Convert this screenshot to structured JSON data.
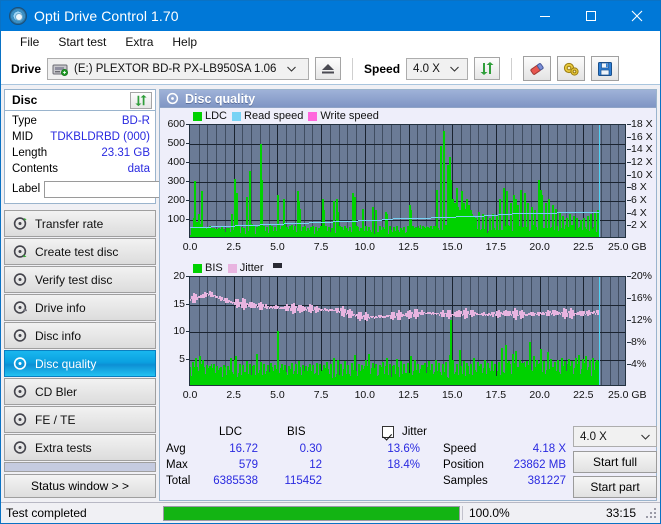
{
  "window": {
    "title": "Opti Drive Control 1.70",
    "icon": "disc-icon",
    "minimize": "minimize-icon",
    "maximize": "maximize-icon",
    "close": "close-icon"
  },
  "menu": {
    "items": [
      "File",
      "Start test",
      "Extra",
      "Help"
    ]
  },
  "toolbar": {
    "drive_label": "Drive",
    "drive_value": "(E:)   PLEXTOR BD-R  PX-LB950SA 1.06",
    "eject_icon": "eject-icon",
    "speed_label": "Speed",
    "speed_value": "4.0 X",
    "refresh_icon": "refresh-icon",
    "eraser_icon": "eraser-icon",
    "settings_icon": "gears-icon",
    "save_icon": "floppy-save-icon"
  },
  "disc": {
    "group_title": "Disc",
    "refresh_icon": "refresh-disc-icon",
    "rows": [
      {
        "key": "Type",
        "value": "BD-R"
      },
      {
        "key": "MID",
        "value": "TDKBLDRBD (000)"
      },
      {
        "key": "Length",
        "value": "23.31 GB"
      },
      {
        "key": "Contents",
        "value": "data"
      }
    ],
    "label_key": "Label",
    "label_value": "",
    "label_placeholder": "",
    "disc_button_icon": "cd-disc-icon"
  },
  "nav": {
    "items": [
      {
        "label": "Transfer rate",
        "selected": false
      },
      {
        "label": "Create test disc",
        "selected": false
      },
      {
        "label": "Verify test disc",
        "selected": false
      },
      {
        "label": "Drive info",
        "selected": false
      },
      {
        "label": "Disc info",
        "selected": false
      },
      {
        "label": "Disc quality",
        "selected": true
      },
      {
        "label": "CD Bler",
        "selected": false
      },
      {
        "label": "FE / TE",
        "selected": false
      },
      {
        "label": "Extra tests",
        "selected": false
      }
    ],
    "status_window": "Status window > >"
  },
  "panel": {
    "title": "Disc quality",
    "icon": "disc-quality-icon"
  },
  "stats": {
    "col_headers": [
      "LDC",
      "BIS"
    ],
    "rows": [
      {
        "key": "Avg",
        "ldc": "16.72",
        "bis": "0.30",
        "jitter": "13.6%"
      },
      {
        "key": "Max",
        "ldc": "579",
        "bis": "12",
        "jitter": "18.4%"
      },
      {
        "key": "Total",
        "ldc": "6385538",
        "bis": "115452",
        "jitter": ""
      }
    ],
    "jitter_label": "Jitter",
    "jitter_checked": true,
    "speed_key": "Speed",
    "speed_value": "4.18 X",
    "position_key": "Position",
    "position_value": "23862 MB",
    "samples_key": "Samples",
    "samples_value": "381227",
    "speed_select_value": "4.0 X",
    "start_full": "Start full",
    "start_part": "Start part"
  },
  "statusbar": {
    "text": "Test completed",
    "percent": "100.0%",
    "progress": 100,
    "time": "33:15"
  },
  "colors": {
    "accent": "#0078d7",
    "plot_bg": "#6b7b96",
    "ldc_green": "#00d200",
    "read_speed": "#78d3f5",
    "write_speed": "#ff66dd",
    "jitter_pink": "#e8b4e0",
    "value_blue": "#2a2ae0",
    "progress_green": "#13b413"
  },
  "chart_data": [
    {
      "type": "area",
      "id": "ldc-chart",
      "title": "",
      "xlabel": "GB",
      "ylabel": "",
      "xlim": [
        0,
        25
      ],
      "ylim": [
        0,
        600
      ],
      "y2lim": [
        0,
        18
      ],
      "y2label": "X",
      "grid": true,
      "legend_position": "top-left",
      "legend": [
        "LDC",
        "Read speed",
        "Write speed"
      ],
      "xticks": [
        0.0,
        2.5,
        5.0,
        7.5,
        10.0,
        12.5,
        15.0,
        17.5,
        20.0,
        22.5,
        25.0
      ],
      "xticklabels": [
        "0.0",
        "2.5",
        "5.0",
        "7.5",
        "10.0",
        "12.5",
        "15.0",
        "17.5",
        "20.0",
        "22.5",
        "25.0 GB"
      ],
      "yticks": [
        100,
        200,
        300,
        400,
        500,
        600
      ],
      "yticklabels": [
        "100",
        "200",
        "300",
        "400",
        "500",
        "600"
      ],
      "y2ticks": [
        2,
        4,
        6,
        8,
        10,
        12,
        14,
        16,
        18
      ],
      "y2ticklabels": [
        "2 X",
        "4 X",
        "6 X",
        "8 X",
        "10 X",
        "12 X",
        "14 X",
        "16 X",
        "18 X"
      ],
      "data_end_x": 23.4,
      "cursor_x": 23.4,
      "series": [
        {
          "name": "LDC",
          "color": "#00d200",
          "baseline": 28,
          "x": [
            0.05,
            0.15,
            0.25,
            0.35,
            0.45,
            0.5,
            0.55,
            0.62,
            0.7,
            0.8,
            0.9,
            1.0,
            1.1,
            1.2,
            1.3,
            1.45,
            1.6,
            1.75,
            1.9,
            2.05,
            2.2,
            2.35,
            2.5,
            2.6,
            2.62,
            2.75,
            2.9,
            3.05,
            3.2,
            3.35,
            3.5,
            3.6,
            3.75,
            3.9,
            4.02,
            4.05,
            4.2,
            4.35,
            4.5,
            4.65,
            4.8,
            4.95,
            5.0,
            5.05,
            5.2,
            5.3,
            5.35,
            5.5,
            5.65,
            5.8,
            5.95,
            6.1,
            6.2,
            6.25,
            6.4,
            6.55,
            6.7,
            6.85,
            7.0,
            7.15,
            7.3,
            7.45,
            7.55,
            7.6,
            7.75,
            7.9,
            8.05,
            8.2,
            8.35,
            8.4,
            8.5,
            8.65,
            8.8,
            8.95,
            9.1,
            9.25,
            9.4,
            9.5,
            9.55,
            9.7,
            9.85,
            10.0,
            10.2,
            10.4,
            10.6,
            10.8,
            11.0,
            11.15,
            11.2,
            11.4,
            11.6,
            11.8,
            12.0,
            12.2,
            12.4,
            12.55,
            12.6,
            12.7,
            12.9,
            13.1,
            13.3,
            13.5,
            13.7,
            13.9,
            14.1,
            14.3,
            14.5,
            14.7,
            14.8,
            14.85,
            14.9,
            15.0,
            15.1,
            15.2,
            15.3,
            15.4,
            15.5,
            15.6,
            15.7,
            15.8,
            15.9,
            16.0,
            16.1,
            16.2,
            16.3,
            16.5,
            16.7,
            16.9,
            17.1,
            17.3,
            17.5,
            17.7,
            17.9,
            18.1,
            18.3,
            18.5,
            18.6,
            18.7,
            18.9,
            19.1,
            19.3,
            19.5,
            19.7,
            19.9,
            20.0,
            20.1,
            20.3,
            20.5,
            20.7,
            20.9,
            21.1,
            21.3,
            21.5,
            21.7,
            21.9,
            22.1,
            22.3,
            22.5,
            22.7,
            22.9,
            23.1,
            23.3
          ],
          "y": [
            55,
            100,
            295,
            80,
            120,
            60,
            70,
            240,
            55,
            45,
            40,
            50,
            60,
            45,
            50,
            40,
            45,
            55,
            40,
            45,
            50,
            120,
            305,
            200,
            230,
            60,
            55,
            50,
            210,
            350,
            70,
            60,
            55,
            65,
            490,
            300,
            60,
            55,
            70,
            60,
            55,
            220,
            210,
            70,
            60,
            200,
            70,
            55,
            60,
            65,
            60,
            240,
            190,
            150,
            55,
            60,
            50,
            55,
            60,
            55,
            50,
            60,
            200,
            140,
            60,
            55,
            50,
            190,
            200,
            130,
            60,
            55,
            60,
            50,
            55,
            230,
            210,
            60,
            55,
            50,
            150,
            60,
            55,
            160,
            140,
            60,
            55,
            130,
            120,
            60,
            55,
            60,
            50,
            55,
            60,
            170,
            140,
            60,
            55,
            50,
            60,
            55,
            50,
            60,
            250,
            480,
            560,
            380,
            420,
            300,
            250,
            200,
            180,
            260,
            160,
            140,
            240,
            180,
            150,
            200,
            170,
            140,
            120,
            110,
            100,
            130,
            120,
            110,
            100,
            120,
            110,
            200,
            260,
            240,
            180,
            220,
            200,
            170,
            250,
            230,
            180,
            160,
            140,
            300,
            250,
            220,
            180,
            200,
            170,
            150,
            130,
            110,
            100,
            120,
            110,
            100,
            90,
            100,
            110,
            120,
            130,
            140
          ]
        },
        {
          "name": "Read speed",
          "color": "#78d3f5",
          "axis": "y2",
          "x": [
            0.0,
            1.2,
            2.6,
            4.0,
            5.4,
            6.8,
            8.2,
            9.6,
            11.0,
            11.6,
            12.4,
            13.8,
            15.2,
            16.0,
            16.8,
            17.6,
            18.4,
            19.2,
            20.0,
            21.0,
            22.2,
            23.2,
            23.4
          ],
          "y": [
            1.9,
            2.1,
            2.25,
            2.4,
            2.55,
            2.7,
            2.85,
            3.0,
            3.15,
            3.3,
            3.35,
            3.5,
            3.6,
            3.7,
            3.8,
            3.9,
            4.05,
            4.1,
            4.15,
            4.2,
            4.25,
            4.3,
            18.0
          ]
        },
        {
          "name": "Write speed",
          "color": "#ff66dd",
          "x": [],
          "y": []
        }
      ]
    },
    {
      "type": "area",
      "id": "bis-chart",
      "title": "",
      "xlabel": "GB",
      "ylabel": "",
      "xlim": [
        0,
        25
      ],
      "ylim": [
        0,
        20
      ],
      "y2lim": [
        0,
        20
      ],
      "y2label": "%",
      "grid": true,
      "legend_position": "top-left",
      "legend": [
        "BIS",
        "Jitter"
      ],
      "xticks": [
        0.0,
        2.5,
        5.0,
        7.5,
        10.0,
        12.5,
        15.0,
        17.5,
        20.0,
        22.5,
        25.0
      ],
      "xticklabels": [
        "0.0",
        "2.5",
        "5.0",
        "7.5",
        "10.0",
        "12.5",
        "15.0",
        "17.5",
        "20.0",
        "22.5",
        "25.0 GB"
      ],
      "yticks": [
        5,
        10,
        15,
        20
      ],
      "yticklabels": [
        "5",
        "10",
        "15",
        "20"
      ],
      "y2ticks": [
        4,
        8,
        12,
        16,
        20
      ],
      "y2ticklabels": [
        "4%",
        "8%",
        "12%",
        "16%",
        "20%"
      ],
      "data_end_x": 23.4,
      "cursor_x": 23.4,
      "series": [
        {
          "name": "BIS",
          "color": "#00d200",
          "baseline": 2.4,
          "x": [
            0.1,
            0.3,
            0.5,
            0.6,
            0.7,
            0.9,
            1.1,
            1.3,
            1.5,
            1.7,
            1.9,
            2.1,
            2.3,
            2.5,
            2.6,
            2.8,
            3.0,
            3.2,
            3.4,
            3.6,
            3.8,
            4.0,
            4.2,
            4.4,
            4.6,
            4.8,
            5.0,
            5.2,
            5.4,
            5.6,
            5.8,
            6.0,
            6.2,
            6.4,
            6.6,
            6.8,
            7.0,
            7.2,
            7.4,
            7.6,
            7.8,
            8.0,
            8.2,
            8.4,
            8.6,
            8.8,
            9.0,
            9.2,
            9.4,
            9.6,
            9.8,
            10.0,
            10.2,
            10.4,
            10.6,
            10.8,
            11.0,
            11.2,
            11.4,
            11.6,
            11.8,
            12.0,
            12.2,
            12.4,
            12.6,
            12.8,
            13.0,
            13.2,
            13.4,
            13.6,
            13.8,
            14.0,
            14.2,
            14.4,
            14.6,
            14.8,
            14.9,
            15.0,
            15.2,
            15.4,
            15.6,
            15.8,
            16.0,
            16.2,
            16.4,
            16.6,
            16.8,
            17.0,
            17.2,
            17.4,
            17.6,
            17.8,
            18.0,
            18.2,
            18.4,
            18.6,
            18.8,
            19.0,
            19.2,
            19.4,
            19.6,
            19.8,
            20.0,
            20.2,
            20.4,
            20.6,
            20.8,
            21.0,
            21.2,
            21.4,
            21.6,
            21.8,
            22.0,
            22.2,
            22.4,
            22.6,
            22.8,
            23.0,
            23.2,
            23.3
          ],
          "y": [
            4.2,
            5.0,
            5.2,
            3.8,
            4.6,
            3.6,
            3.4,
            3.8,
            3.5,
            3.2,
            3.6,
            3.4,
            5.0,
            4.6,
            5.2,
            3.8,
            3.6,
            4.4,
            3.8,
            3.6,
            5.6,
            4.2,
            3.8,
            3.6,
            4.0,
            3.6,
            9.8,
            3.8,
            3.6,
            3.4,
            4.0,
            3.8,
            4.4,
            3.6,
            3.4,
            3.8,
            3.6,
            4.0,
            3.8,
            3.6,
            4.2,
            3.8,
            5.0,
            4.6,
            3.8,
            4.4,
            3.6,
            4.0,
            5.4,
            3.8,
            3.6,
            4.6,
            5.6,
            4.0,
            3.8,
            3.6,
            4.2,
            5.0,
            3.8,
            3.6,
            4.8,
            4.4,
            3.8,
            4.0,
            5.2,
            4.6,
            3.8,
            3.6,
            4.0,
            4.4,
            3.8,
            4.6,
            4.0,
            3.8,
            4.2,
            5.4,
            11.8,
            4.6,
            3.8,
            6.4,
            4.4,
            4.0,
            3.8,
            5.0,
            4.2,
            3.8,
            4.6,
            4.0,
            4.4,
            3.8,
            4.2,
            6.8,
            7.2,
            4.4,
            5.6,
            6.2,
            4.6,
            4.0,
            4.4,
            7.8,
            5.2,
            4.6,
            6.6,
            4.4,
            6.0,
            4.8,
            4.2,
            4.6,
            5.0,
            4.4,
            4.8,
            4.4,
            5.0,
            5.4,
            4.8,
            5.2,
            4.6,
            5.0,
            4.6,
            4.4
          ]
        },
        {
          "name": "Jitter",
          "color": "#e8b4e0",
          "axis": "y2",
          "avg": 13.6,
          "max": 18.4,
          "x_start": 0.0,
          "x_end": 23.4,
          "trend": [
            16.0,
            16.4,
            17.0,
            16.2,
            15.6,
            15.2,
            15.0,
            14.8,
            14.6,
            14.5,
            14.4,
            14.3,
            14.2,
            14.2,
            14.1,
            14.0,
            13.9,
            13.4,
            12.9,
            12.7,
            12.8,
            12.9,
            13.0,
            13.1,
            13.3,
            13.5,
            13.4,
            13.3,
            13.2,
            13.3,
            13.4,
            13.3,
            13.2,
            13.3,
            13.4,
            13.3,
            13.2,
            13.3,
            13.4,
            13.5,
            13.4,
            13.3,
            13.4,
            13.5,
            13.6
          ]
        }
      ]
    }
  ]
}
